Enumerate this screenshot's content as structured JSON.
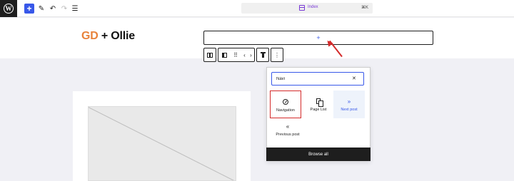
{
  "toolbar": {
    "logo_icon": "wordpress-logo-icon",
    "add_label": "+",
    "brush_glyph": "✎",
    "undo_glyph": "↶",
    "redo_glyph": "↷",
    "list_glyph": "☰",
    "command_bar": {
      "label": "Index",
      "shortcut": "⌘K",
      "icon": "template-icon"
    }
  },
  "site": {
    "title_accent": "GD",
    "title_rest": "+ Ollie",
    "accent_color": "#e8823a"
  },
  "nav_placeholder": {
    "plus": "+"
  },
  "block_toolbar": {
    "parent_icon": "columns-icon",
    "block_icon": "block-icon",
    "drag_glyph": "⠿",
    "prev_glyph": "‹",
    "next_glyph": "›",
    "align_icon": "align-top-icon",
    "more_glyph": "⋮"
  },
  "inserter": {
    "search_value": "Navi",
    "clear_glyph": "✕",
    "blocks": [
      {
        "label": "Navigation",
        "icon": "compass-icon"
      },
      {
        "label": "Page List",
        "icon": "pages-icon"
      },
      {
        "label": "Next post",
        "glyph": "»",
        "icon": "next-icon"
      },
      {
        "label": "Previous post",
        "glyph": "«",
        "icon": "previous-icon"
      }
    ],
    "browse_all": "Browse all"
  },
  "colors": {
    "primary": "#3858e9",
    "annotation": "#d42a2a",
    "dark": "#1e1e1e"
  }
}
